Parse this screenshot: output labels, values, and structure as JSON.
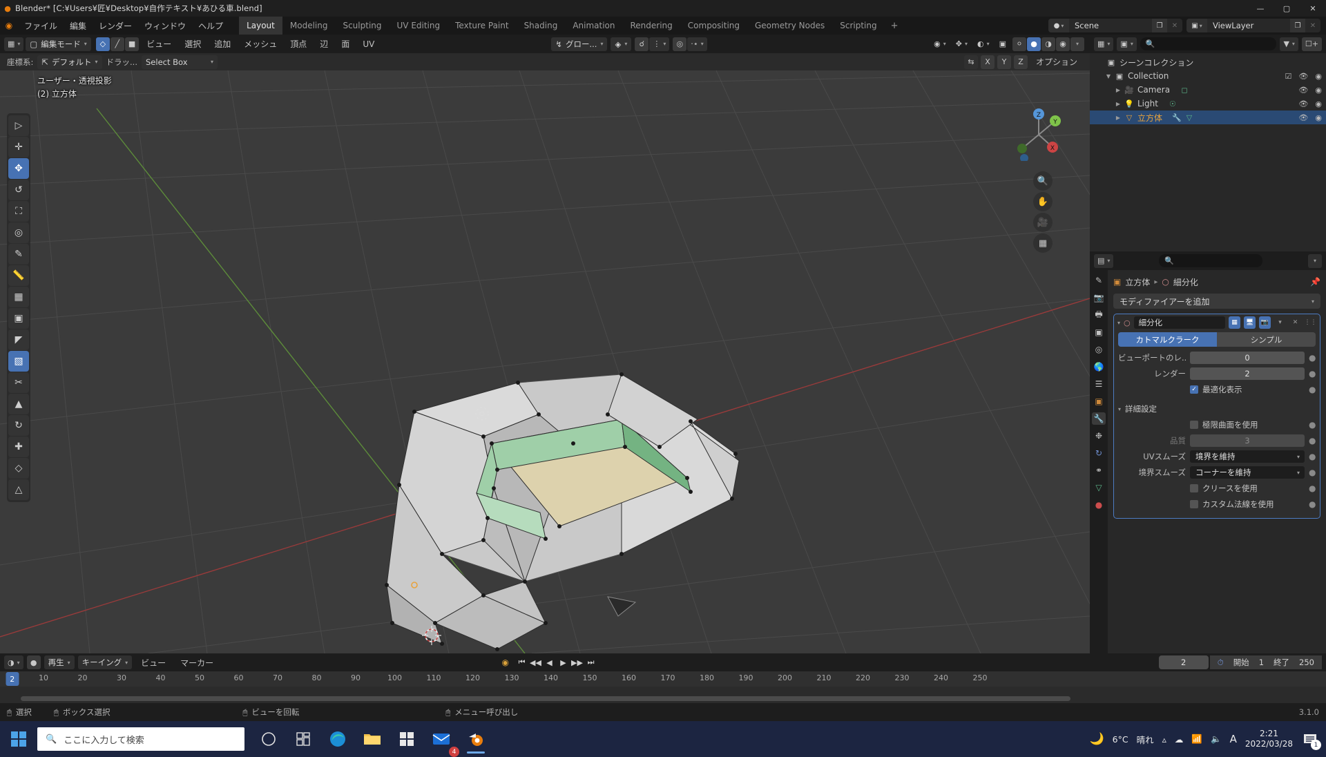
{
  "titlebar": {
    "text": "Blender* [C:¥Users¥匠¥Desktop¥自作テキスト¥あひる車.blend]",
    "icon": "blender-logo-icon",
    "minimize": "—",
    "maximize": "▢",
    "close": "✕"
  },
  "topbar": {
    "menus": [
      "ファイル",
      "編集",
      "レンダー",
      "ウィンドウ",
      "ヘルプ"
    ],
    "workspaces": [
      {
        "label": "Layout",
        "active": true
      },
      {
        "label": "Modeling",
        "active": false
      },
      {
        "label": "Sculpting",
        "active": false
      },
      {
        "label": "UV Editing",
        "active": false
      },
      {
        "label": "Texture Paint",
        "active": false
      },
      {
        "label": "Shading",
        "active": false
      },
      {
        "label": "Animation",
        "active": false
      },
      {
        "label": "Rendering",
        "active": false
      },
      {
        "label": "Compositing",
        "active": false
      },
      {
        "label": "Geometry Nodes",
        "active": false
      },
      {
        "label": "Scripting",
        "active": false
      }
    ],
    "add_workspace": "+",
    "scene_name": "Scene",
    "viewlayer_name": "ViewLayer"
  },
  "viewport": {
    "header": {
      "editor_type": "editor-type-icon",
      "mode": "編集モード",
      "select_modes": [
        "vertex-select",
        "edge-select",
        "face-select"
      ],
      "menus": [
        "ビュー",
        "選択",
        "追加",
        "メッシュ",
        "頂点",
        "辺",
        "面",
        "UV"
      ],
      "orientation": "グロー...",
      "pivot": "pivot-icon",
      "snap": "snap-magnet-icon",
      "proportional": "proportional-edit-icon"
    },
    "subheader": {
      "transform_label": "座標系:",
      "transform_value": "デフォルト",
      "drag_label": "ドラッ...",
      "drag_value": "Select Box",
      "options_label": "オプション",
      "axis_xyz": [
        "X",
        "Y",
        "Z"
      ]
    },
    "overlay_line1": "ユーザー・透視投影",
    "overlay_line2": "(2) 立方体",
    "tools": [
      "tweak-select-tool",
      "cursor-tool",
      "move-tool",
      "rotate-tool",
      "scale-tool",
      "transform-tool",
      "annotate-tool",
      "measure-tool",
      "extrude-region-tool",
      "inset-faces-tool",
      "bevel-tool",
      "loop-cut-tool",
      "knife-tool",
      "poly-build-tool",
      "spin-tool",
      "smooth-tool",
      "edge-slide-tool",
      "shrink-fatten-tool",
      "shear-tool",
      "rip-region-tool"
    ],
    "nav": {
      "zoom": "zoom-icon",
      "pan": "hand-pan-icon",
      "camera": "camera-view-icon",
      "ortho": "toggle-ortho-icon",
      "axis_x": "X",
      "axis_y": "Y",
      "axis_z": "Z"
    }
  },
  "outliner": {
    "display_mode": "view-layer-icon",
    "search_placeholder": "",
    "filter_icon": "filter-icon",
    "new_collection_icon": "new-collection-icon",
    "rows": [
      {
        "indent": 0,
        "tri": "",
        "icon": "collection-icon",
        "name": "シーンコレクション",
        "selected": false,
        "checkbox": false,
        "eye": false,
        "cam": false
      },
      {
        "indent": 1,
        "tri": "▼",
        "icon": "collection-icon",
        "name": "Collection",
        "selected": false,
        "checkbox": true,
        "eye": true,
        "cam": true
      },
      {
        "indent": 2,
        "tri": "▶",
        "icon": "camera-data-icon",
        "name": "Camera",
        "selected": false,
        "checkbox": false,
        "eye": true,
        "cam": true
      },
      {
        "indent": 2,
        "tri": "▶",
        "icon": "light-data-icon",
        "name": "Light",
        "selected": false,
        "checkbox": false,
        "eye": true,
        "cam": true
      },
      {
        "indent": 2,
        "tri": "▶",
        "icon": "mesh-object-icon",
        "name": "立方体",
        "selected": true,
        "checkbox": false,
        "eye": true,
        "cam": true
      }
    ]
  },
  "properties": {
    "editor_icon": "properties-editor-icon",
    "search_placeholder": "",
    "breadcrumb_object": "立方体",
    "breadcrumb_modifier": "細分化",
    "pin_icon": "pin-icon",
    "tabs": [
      "tool-tab",
      "render-tab",
      "output-tab",
      "view-layer-tab",
      "scene-tab",
      "world-tab",
      "collection-tab",
      "object-tab",
      "modifier-tab",
      "particles-tab",
      "physics-tab",
      "constraints-tab",
      "data-tab",
      "material-tab"
    ],
    "active_tab_index": 8,
    "add_modifier": "モディファイアーを追加",
    "modifier": {
      "icon": "subdivision-surface-icon",
      "name": "細分化",
      "toggles": [
        "edit-mode-display",
        "realtime-display",
        "render-display"
      ],
      "dropdown_icon": "chevron-down-icon",
      "close_icon": "close-icon",
      "drag_icon": "drag-handle-icon",
      "type_options": [
        {
          "label": "カトマルクラーク",
          "selected": true
        },
        {
          "label": "シンプル",
          "selected": false
        }
      ],
      "fields": [
        {
          "label": "ビューポートのレ...",
          "value": "0"
        },
        {
          "label": "レンダー",
          "value": "2"
        }
      ],
      "optimal_display": {
        "label": "最適化表示",
        "checked": true
      },
      "advanced_section": "詳細設定",
      "advanced": [
        {
          "type": "checkbox",
          "label": "極限曲面を使用",
          "checked": false
        },
        {
          "type": "value",
          "label": "品質",
          "value": "3",
          "disabled": true
        },
        {
          "type": "dropdown",
          "label": "UVスムーズ",
          "value": "境界を維持"
        },
        {
          "type": "dropdown",
          "label": "境界スムーズ",
          "value": "コーナーを維持"
        },
        {
          "type": "checkbox",
          "label": "クリースを使用",
          "checked": false
        },
        {
          "type": "checkbox",
          "label": "カスタム法線を使用",
          "checked": false
        }
      ]
    }
  },
  "timeline": {
    "editor_icon": "timeline-editor-icon",
    "menus": [
      "再生",
      "キーイング",
      "ビュー",
      "マーカー"
    ],
    "auto_key_icon": "record-icon",
    "play_controls": [
      "jump-start",
      "prev-keyframe",
      "play-reverse",
      "play",
      "next-keyframe",
      "jump-end"
    ],
    "current_frame": "2",
    "clock_icon": "use-preview-range-icon",
    "start_label": "開始",
    "start_value": "1",
    "end_label": "終了",
    "end_value": "250",
    "ticks": [
      "10",
      "20",
      "30",
      "40",
      "50",
      "60",
      "70",
      "80",
      "90",
      "100",
      "110",
      "120",
      "130",
      "140",
      "150",
      "160",
      "170",
      "180",
      "190",
      "200",
      "210",
      "220",
      "230",
      "240",
      "250"
    ],
    "playhead_frame": "2"
  },
  "statusbar": {
    "items": [
      {
        "icon": "mouse-left-icon",
        "label": "選択"
      },
      {
        "icon": "mouse-left-drag-icon",
        "label": "ボックス選択"
      },
      {
        "icon": "mouse-middle-icon",
        "label": "ビューを回転"
      },
      {
        "icon": "mouse-right-icon",
        "label": "メニュー呼び出し"
      }
    ],
    "version": "3.1.0"
  },
  "taskbar": {
    "start_icon": "windows-start-icon",
    "search_placeholder": "ここに入力して検索",
    "search_icon": "search-icon",
    "apps": [
      {
        "name": "task-view-icon",
        "active": false
      },
      {
        "name": "widgets-icon",
        "active": false
      },
      {
        "name": "edge-browser-icon",
        "active": false
      },
      {
        "name": "file-explorer-icon",
        "active": false
      },
      {
        "name": "microsoft-store-icon",
        "active": false
      },
      {
        "name": "mail-icon",
        "active": false,
        "badge": "4"
      },
      {
        "name": "blender-app-icon",
        "active": true
      }
    ],
    "weather_icon": "moon-icon",
    "temperature": "6°C",
    "weather_text": "晴れ",
    "tray": [
      "chevron-up-icon",
      "onedrive-icon",
      "network-icon",
      "volume-icon",
      "ime-A-icon"
    ],
    "time": "2:21",
    "date": "2022/03/28",
    "notification_icon": "notification-icon",
    "notification_count": "1"
  },
  "colors": {
    "accent": "#4772b3",
    "selected_orange": "#e8a33d",
    "viewport_bg": "#3b3b3b",
    "taskbar_bg": "#1c2541"
  }
}
